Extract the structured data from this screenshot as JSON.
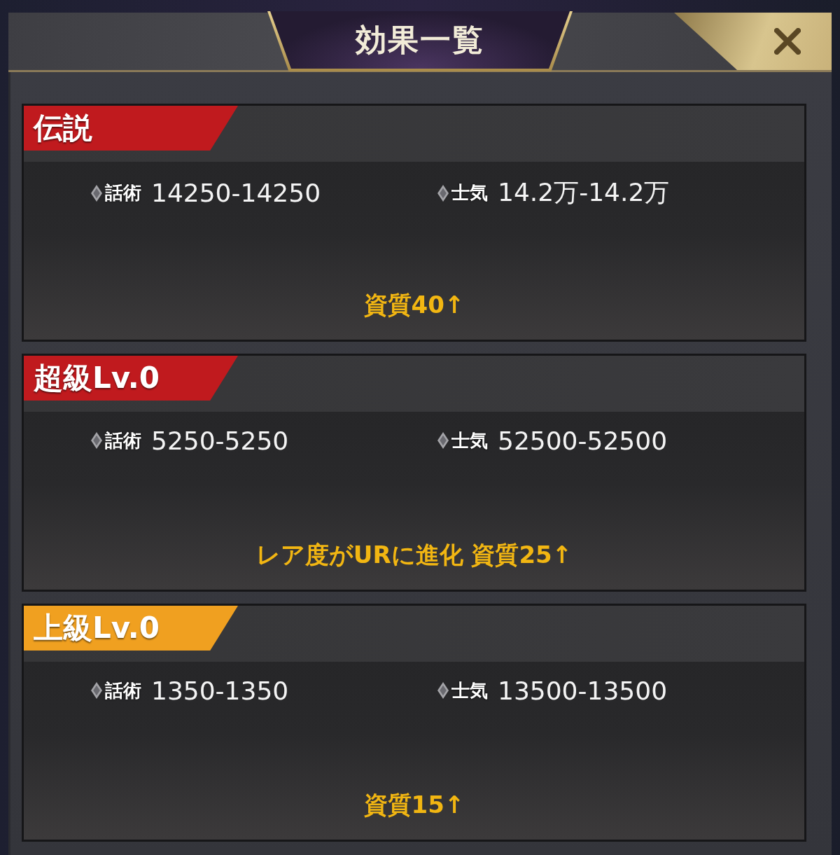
{
  "dialog": {
    "title": "効果一覧"
  },
  "tiers": [
    {
      "name": "伝説",
      "color": "#c01a1e",
      "stats": [
        {
          "label": "話術",
          "value": "14250-14250"
        },
        {
          "label": "士気",
          "value": "14.2万-14.2万"
        }
      ],
      "bonus": "資質40↑"
    },
    {
      "name": "超級Lv.0",
      "color": "#c01a1e",
      "stats": [
        {
          "label": "話術",
          "value": "5250-5250"
        },
        {
          "label": "士気",
          "value": "52500-52500"
        }
      ],
      "bonus": "レア度がURに進化 資質25↑"
    },
    {
      "name": "上級Lv.0",
      "color": "#f0a020",
      "stats": [
        {
          "label": "話術",
          "value": "1350-1350"
        },
        {
          "label": "士気",
          "value": "13500-13500"
        }
      ],
      "bonus": "資質15↑"
    }
  ]
}
